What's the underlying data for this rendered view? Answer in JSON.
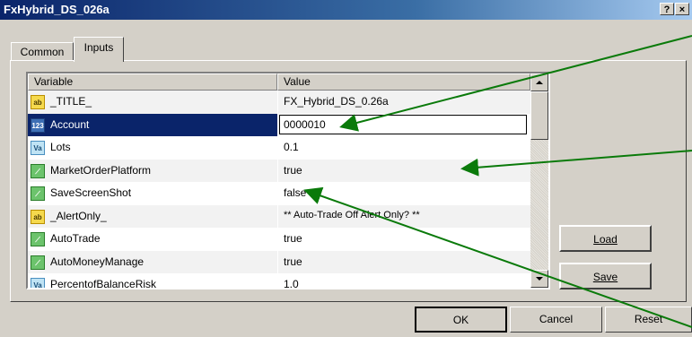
{
  "window": {
    "title": "FxHybrid_DS_026a",
    "help_label": "?",
    "close_label": "×"
  },
  "tabs": [
    {
      "label": "Common"
    },
    {
      "label": "Inputs"
    }
  ],
  "grid": {
    "headers": {
      "variable": "Variable",
      "value": "Value"
    },
    "rows": [
      {
        "icon": "ab",
        "variable": "_TITLE_",
        "value": "FX_Hybrid_DS_0.26a"
      },
      {
        "icon": "123",
        "variable": "Account",
        "value": "0000010"
      },
      {
        "icon": "Va",
        "variable": "Lots",
        "value": "0.1"
      },
      {
        "icon": "bool",
        "variable": "MarketOrderPlatform",
        "value": "true"
      },
      {
        "icon": "bool",
        "variable": "SaveScreenShot",
        "value": "false"
      },
      {
        "icon": "ab",
        "variable": "_AlertOnly_",
        "value": "** Auto-Trade Off Alert Only? **"
      },
      {
        "icon": "bool",
        "variable": "AutoTrade",
        "value": "true"
      },
      {
        "icon": "bool",
        "variable": "AutoMoneyManage",
        "value": "true"
      },
      {
        "icon": "Va",
        "variable": "PercentofBalanceRisk",
        "value": "1.0"
      }
    ]
  },
  "buttons": {
    "load": "Load",
    "save": "Save",
    "ok": "OK",
    "cancel": "Cancel",
    "reset": "Reset"
  },
  "annotation_color": "#0a7a0a"
}
